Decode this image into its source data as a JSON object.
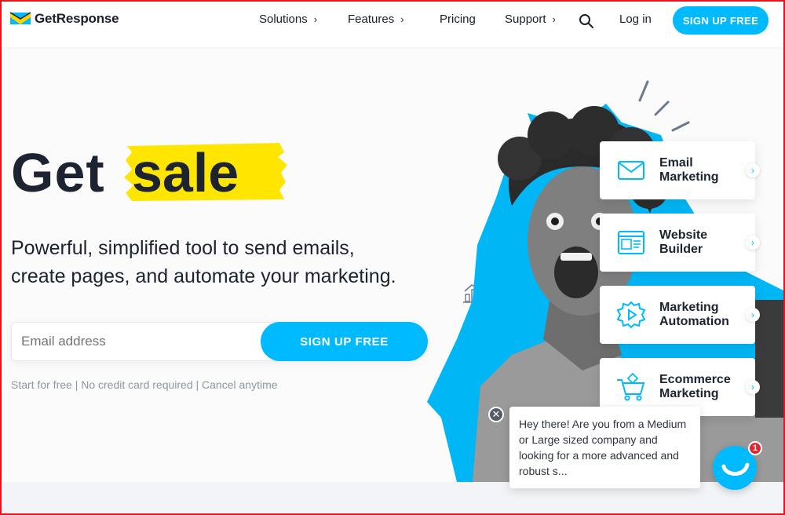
{
  "header": {
    "logo_text": "GetResponse",
    "nav": [
      {
        "label": "Solutions",
        "has_chevron": true
      },
      {
        "label": "Features",
        "has_chevron": true
      },
      {
        "label": "Pricing",
        "has_chevron": false
      },
      {
        "label": "Support",
        "has_chevron": true
      }
    ],
    "chevron_glyph": "›",
    "search_icon": "search-icon",
    "login_label": "Log in",
    "signup_label": "SIGN UP FREE"
  },
  "hero": {
    "headline_word1": "Get",
    "headline_word2": "sale",
    "subheadline_line1": "Powerful, simplified tool to send emails,",
    "subheadline_line2": "create pages, and automate your marketing.",
    "email_placeholder": "Email address",
    "signup_label": "SIGN UP FREE",
    "note": "Start for free | No credit card required | Cancel anytime"
  },
  "cards": [
    {
      "label_line1": "Email",
      "label_line2": "Marketing",
      "icon": "envelope-icon"
    },
    {
      "label_line1": "Website",
      "label_line2": "Builder",
      "icon": "website-icon"
    },
    {
      "label_line1": "Marketing",
      "label_line2": "Automation",
      "icon": "automation-gear-icon"
    },
    {
      "label_line1": "Ecommerce",
      "label_line2": "Marketing",
      "icon": "cart-icon"
    }
  ],
  "card_arrow_glyph": "›",
  "chat": {
    "message": "Hey there! Are you from a Medium or Large sized company and looking for a more advanced and robust s...",
    "close_glyph": "✕",
    "badge_count": "1"
  },
  "colors": {
    "accent": "#00baff",
    "highlight": "#ffe600",
    "text": "#1d2330",
    "badge": "#e0262f"
  }
}
